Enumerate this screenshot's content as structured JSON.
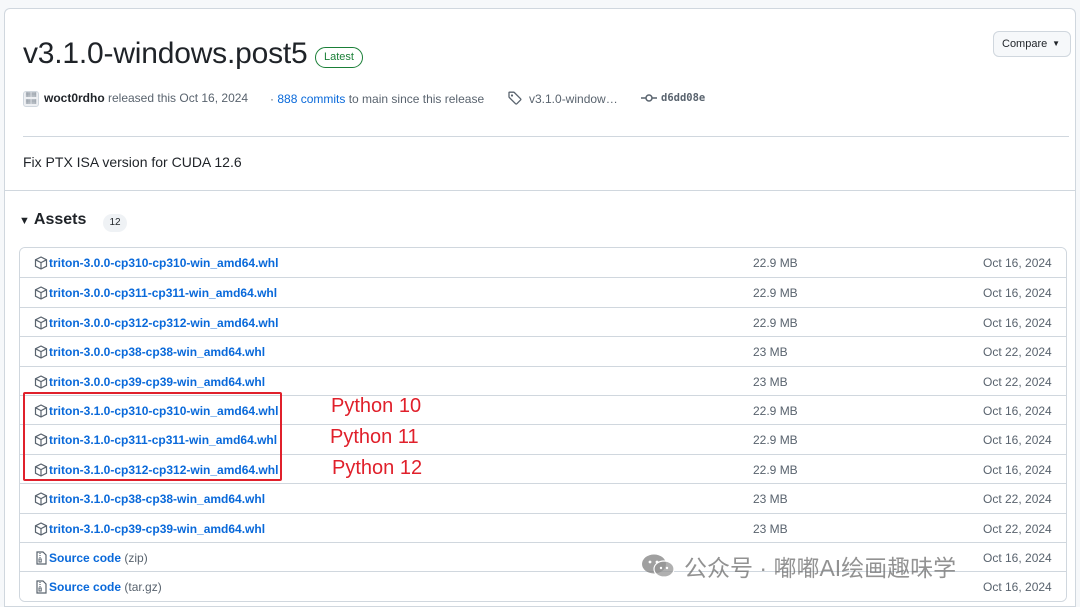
{
  "release": {
    "title": "v3.1.0-windows.post5",
    "badge": "Latest",
    "compare_label": "Compare",
    "author": "woct0rdho",
    "released_text": "released this Oct 16, 2024",
    "commits_link": "888 commits",
    "commits_suffix": "to main since this release",
    "tag": "v3.1.0-window…",
    "commit_sha": "d6dd08e",
    "body": "Fix PTX ISA version for CUDA 12.6"
  },
  "assets": {
    "heading": "Assets",
    "count": "12",
    "rows": [
      {
        "name": "triton-3.0.0-cp310-cp310-win_amd64.whl",
        "suffix": "",
        "size": "22.9 MB",
        "date": "Oct 16, 2024",
        "icon": "package-icon"
      },
      {
        "name": "triton-3.0.0-cp311-cp311-win_amd64.whl",
        "suffix": "",
        "size": "22.9 MB",
        "date": "Oct 16, 2024",
        "icon": "package-icon"
      },
      {
        "name": "triton-3.0.0-cp312-cp312-win_amd64.whl",
        "suffix": "",
        "size": "22.9 MB",
        "date": "Oct 16, 2024",
        "icon": "package-icon"
      },
      {
        "name": "triton-3.0.0-cp38-cp38-win_amd64.whl",
        "suffix": "",
        "size": "23 MB",
        "date": "Oct 22, 2024",
        "icon": "package-icon"
      },
      {
        "name": "triton-3.0.0-cp39-cp39-win_amd64.whl",
        "suffix": "",
        "size": "23 MB",
        "date": "Oct 22, 2024",
        "icon": "package-icon"
      },
      {
        "name": "triton-3.1.0-cp310-cp310-win_amd64.whl",
        "suffix": "",
        "size": "22.9 MB",
        "date": "Oct 16, 2024",
        "icon": "package-icon"
      },
      {
        "name": "triton-3.1.0-cp311-cp311-win_amd64.whl",
        "suffix": "",
        "size": "22.9 MB",
        "date": "Oct 16, 2024",
        "icon": "package-icon"
      },
      {
        "name": "triton-3.1.0-cp312-cp312-win_amd64.whl",
        "suffix": "",
        "size": "22.9 MB",
        "date": "Oct 16, 2024",
        "icon": "package-icon"
      },
      {
        "name": "triton-3.1.0-cp38-cp38-win_amd64.whl",
        "suffix": "",
        "size": "23 MB",
        "date": "Oct 22, 2024",
        "icon": "package-icon"
      },
      {
        "name": "triton-3.1.0-cp39-cp39-win_amd64.whl",
        "suffix": "",
        "size": "23 MB",
        "date": "Oct 22, 2024",
        "icon": "package-icon"
      },
      {
        "name": "Source code",
        "suffix": "(zip)",
        "size": "",
        "date": "Oct 16, 2024",
        "icon": "file-zip-icon"
      },
      {
        "name": "Source code",
        "suffix": "(tar.gz)",
        "size": "",
        "date": "Oct 16, 2024",
        "icon": "file-zip-icon"
      }
    ]
  },
  "annotations": {
    "python10": "Python 10",
    "python11": "Python 11",
    "python12": "Python 12",
    "color": "#e0202b"
  },
  "watermark": {
    "text": "公众号 · 嘟嘟AI绘画趣味学",
    "icon": "wechat-icon"
  },
  "colors": {
    "link": "#0969da",
    "latest_green": "#1a7f37",
    "border": "#d0d7de",
    "muted": "#59636e"
  }
}
